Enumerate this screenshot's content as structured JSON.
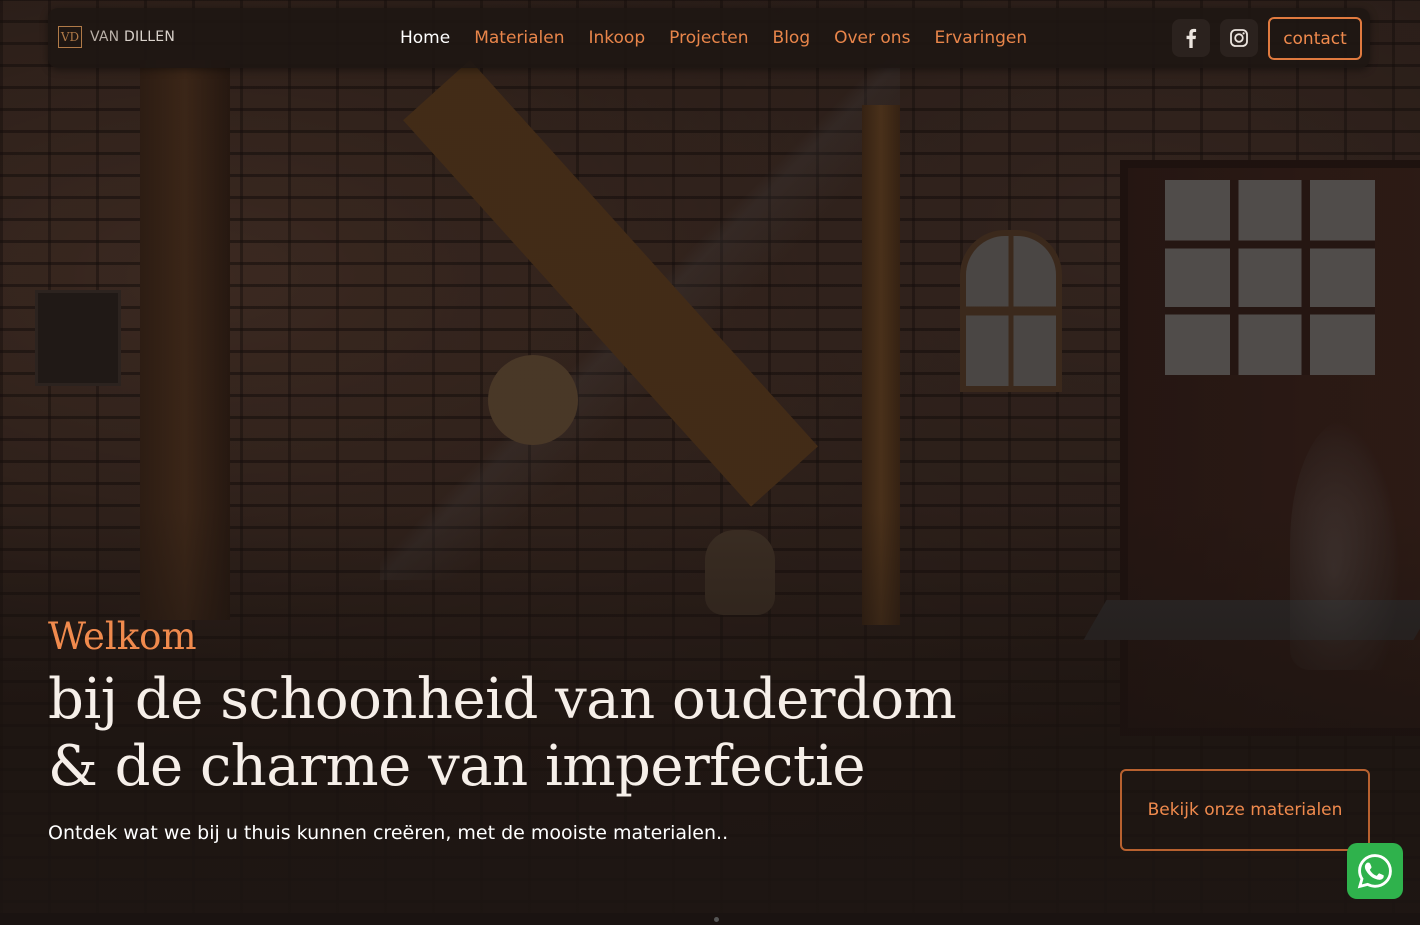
{
  "brand": {
    "mark": "VD",
    "name_part1": "VAN",
    "name_part2": "DILLEN"
  },
  "nav": {
    "items": [
      {
        "label": "Home",
        "active": true
      },
      {
        "label": "Materialen",
        "active": false
      },
      {
        "label": "Inkoop",
        "active": false
      },
      {
        "label": "Projecten",
        "active": false
      },
      {
        "label": "Blog",
        "active": false
      },
      {
        "label": "Over ons",
        "active": false
      },
      {
        "label": "Ervaringen",
        "active": false
      }
    ],
    "social": [
      {
        "icon": "facebook-icon"
      },
      {
        "icon": "instagram-icon"
      }
    ],
    "contact_label": "contact"
  },
  "hero": {
    "kicker": "Welkom",
    "title_line1": "bij de schoonheid van ouderdom",
    "title_line2": "& de charme van imperfectie",
    "subtitle": "Ontdek wat we bij u thuis kunnen creëren, met de mooiste materialen..",
    "cta_label": "Bekijk onze materialen"
  },
  "floating": {
    "icon": "whatsapp-icon"
  },
  "colors": {
    "accent": "#f08a4d",
    "nav_bg": "#1e1613",
    "whatsapp": "#2fb24c"
  }
}
